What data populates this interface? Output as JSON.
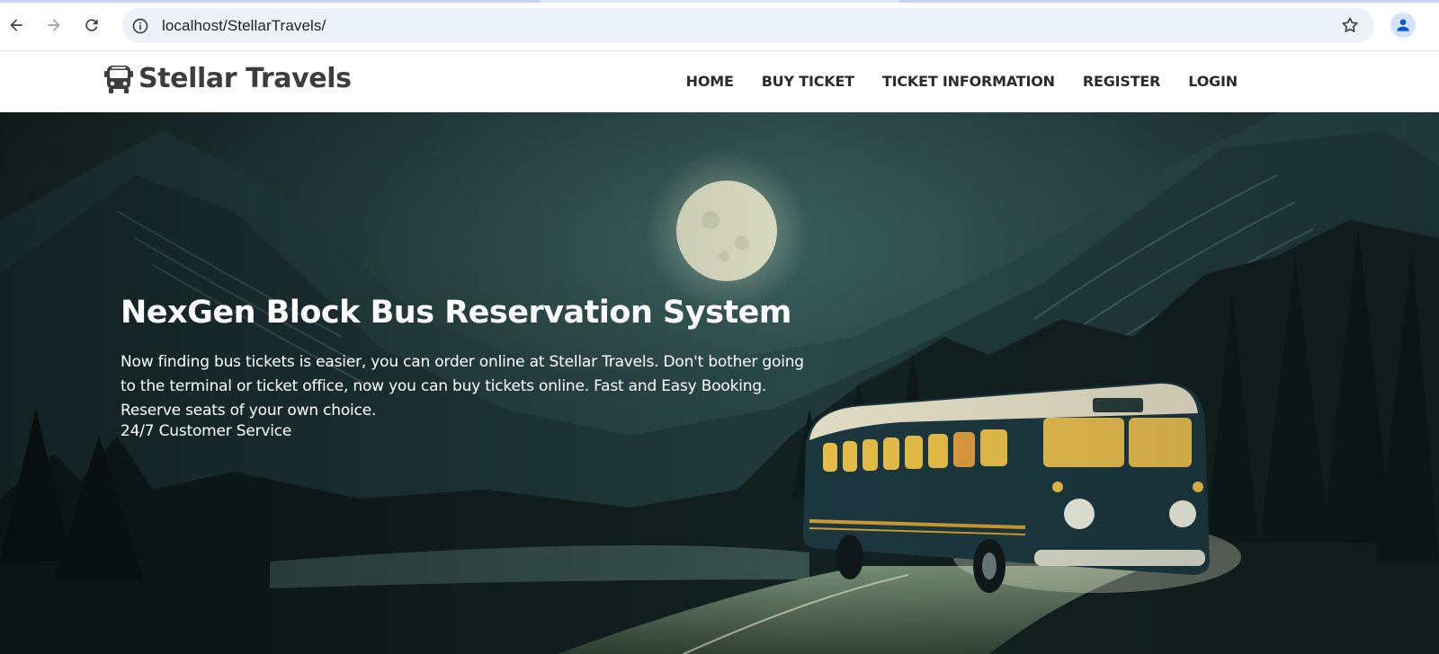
{
  "browser": {
    "url": "localhost/StellarTravels/",
    "icons": {
      "back": "back-arrow-icon",
      "forward": "forward-arrow-icon",
      "reload": "reload-icon",
      "site_info": "info-icon",
      "bookmark": "star-icon",
      "profile": "profile-icon"
    }
  },
  "site": {
    "brand": "Stellar Travels",
    "brand_icon": "bus-icon",
    "nav": [
      {
        "label": "HOME"
      },
      {
        "label": "BUY TICKET"
      },
      {
        "label": "TICKET INFORMATION"
      },
      {
        "label": "REGISTER"
      },
      {
        "label": "LOGIN"
      }
    ]
  },
  "hero": {
    "title": "NexGen Block Bus Reservation System",
    "description": "Now finding bus tickets is easier, you can order online at Stellar Travels. Don't bother going to the terminal or ticket office, now you can buy tickets online. Fast and Easy Booking. Reserve seats of your own choice.",
    "service": "24/7 Customer Service",
    "background": "night-mountain-bus-illustration"
  },
  "colors": {
    "hero_bg": "#1b2a2a",
    "brand_text": "#3d3d3d",
    "omnibox_bg": "#edf2fa"
  }
}
